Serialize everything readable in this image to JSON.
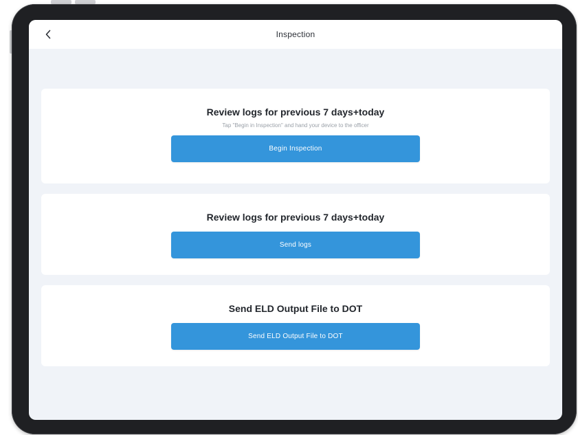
{
  "header": {
    "title": "Inspection",
    "back_icon": "chevron-left-icon"
  },
  "cards": [
    {
      "title": "Review logs for previous 7 days+today",
      "subtitle": "Tap \"Begin in Inspection\" and hand your device to the officer",
      "button_label": "Begin Inspection"
    },
    {
      "title": "Review logs for previous 7 days+today",
      "button_label": "Send logs"
    },
    {
      "title": "Send ELD Output File to DOT",
      "button_label": "Send ELD Output File to DOT"
    }
  ],
  "colors": {
    "accent": "#3495db",
    "background": "#f0f3f8",
    "card": "#ffffff",
    "device_frame": "#1f2023"
  }
}
